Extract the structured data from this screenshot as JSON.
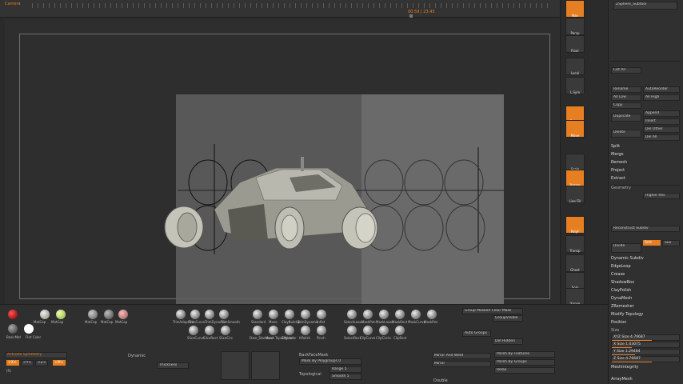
{
  "timeline": {
    "label": "Camera",
    "frame_readout": "00:59 | 23:45"
  },
  "toolcol": {
    "buttons": [
      "Nav",
      "Persp",
      "Floor",
      "Local",
      "L.Sym",
      "Frame",
      "Move",
      "Scale",
      "Rotate",
      "Line Fill",
      "PolyF",
      "Transp",
      "Ghost",
      "Solo",
      "Xpose"
    ]
  },
  "rpanel": {
    "header": "ZSphere_Subtool",
    "list_all": "List All",
    "rename": "Rename",
    "autoreorder": "AutoReorder",
    "all_low": "All Low",
    "all_high": "All High",
    "copy": "Copy",
    "paste": "Paste",
    "duplicate": "Duplicate",
    "append": "Append",
    "insert": "Insert",
    "delete": "Delete",
    "del_other": "Del Other",
    "del_all": "Del All",
    "split": "Split",
    "merge": "Merge",
    "remesh": "Remesh",
    "project": "Project",
    "extract": "Extract",
    "geometry": "Geometry",
    "higher_res": "Higher Res",
    "reconstruct": "Reconstruct Subdiv",
    "divide": "Divide",
    "smt": "Smt",
    "suv": "Suv",
    "dynamic_subdiv": "Dynamic Subdiv",
    "edgeloop": "EdgeLoop",
    "crease": "Crease",
    "shadowbox": "ShadowBox",
    "claypolish": "ClayPolish",
    "dynamesh": "DynaMesh",
    "zremesher": "ZRemesher",
    "modify_topology": "Modify Topology",
    "position": "Position",
    "size": "Size",
    "xyz_size_label": "XYZ Size",
    "xyz_size": "4.76687",
    "x_size_label": "X Size",
    "x_size": "1.03075",
    "y_size_label": "Y Size",
    "y_size": "1.29484",
    "z_size_label": "Z Size",
    "z_size": "4.76687",
    "meshintegrity": "MeshIntegrity",
    "arraymesh": "ArrayMesh"
  },
  "shelf": {
    "materials": [
      "MatCap",
      "MatCap",
      "MatCap",
      "MatCap",
      "MatCap",
      "MatCap",
      "MatCap"
    ],
    "basic_mat": "BasicMat",
    "flat_color": "Flat Color",
    "brushes_row1": [
      "TrimAdaptive",
      "TrimCurve",
      "TrimDynamic",
      "TrimSmooth"
    ],
    "brushes_row2": [
      "SliceCurve",
      "SliceRect",
      "SliceCirc"
    ],
    "brushes_row3": [
      "Standard",
      "Move",
      "ClayBuildup",
      "TrimDynamic",
      "Inflat"
    ],
    "brushes_row4": [
      "Dam_Standard",
      "Move Topological",
      "ZModeler",
      "hPolish",
      "Pinch"
    ],
    "brushes_row5": [
      "SelectLasso",
      "MaskPen",
      "MaskLasso",
      "MaskRect",
      "MaskCurve",
      "MaskPen"
    ],
    "brushes_row6": [
      "SelectRect",
      "ClipCurve",
      "ClipCircle",
      "ClipRect"
    ],
    "group_masked": "Group Masked Clear Mask",
    "group_visible": "GroupVisible",
    "auto_groups": "Auto Groups",
    "del_hidden": "Del Hidden",
    "activate_symmetry": "Activate Symmetry",
    "sym_x": ">X<",
    "sym_y": ">Y<",
    "sym_z": ">Z<",
    "sym_m": ">M<",
    "sym_r": "(R)",
    "dynamic": "Dynamic",
    "thickness": "Thickness",
    "backface_mask": "BackFaceMask",
    "mask_by_polygroups": "Mask By Polygroups 0",
    "range": "Range 5",
    "topological": "Topological",
    "smooth": "Smooth 5",
    "mirror_and_weld": "Mirror And Weld",
    "mirror": "Mirror",
    "double": "Double",
    "polish_by_features": "Polish By Features",
    "polish_by_groups": "Polish By Groups",
    "relax": "Relax"
  },
  "colors": {
    "accent": "#e67e22",
    "bg": "#2a2a2a",
    "panel": "#303030"
  }
}
